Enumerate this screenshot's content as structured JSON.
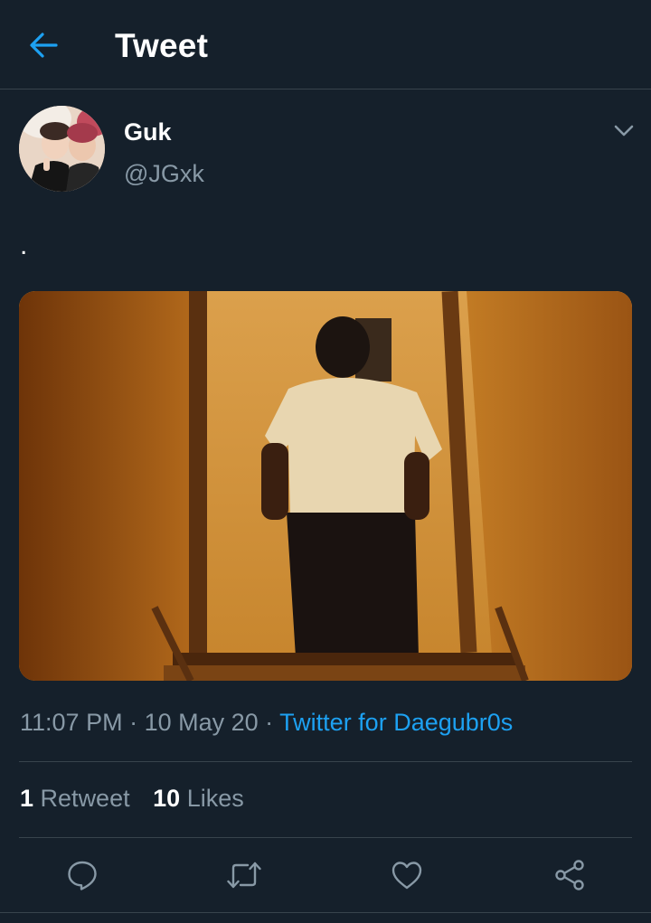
{
  "header": {
    "title": "Tweet",
    "back_icon": "arrow-left-icon"
  },
  "tweet": {
    "author": {
      "display_name": "Guk",
      "handle": "@JGxk"
    },
    "text": ".",
    "meta": {
      "time": "11:07 PM",
      "separator": " · ",
      "date": "10 May 20",
      "source": "Twitter for Daegubr0s"
    },
    "stats": {
      "retweets_count": "1",
      "retweets_label": "Retweet",
      "likes_count": "10",
      "likes_label": "Likes"
    }
  },
  "actions": [
    {
      "name": "reply",
      "icon": "reply-bubble-icon"
    },
    {
      "name": "retweet",
      "icon": "retweet-icon"
    },
    {
      "name": "like",
      "icon": "heart-icon"
    },
    {
      "name": "share",
      "icon": "share-icon"
    }
  ],
  "colors": {
    "background": "#15202b",
    "accent": "#1da1f2",
    "secondary_text": "#8899a6",
    "divider": "#38444d"
  }
}
